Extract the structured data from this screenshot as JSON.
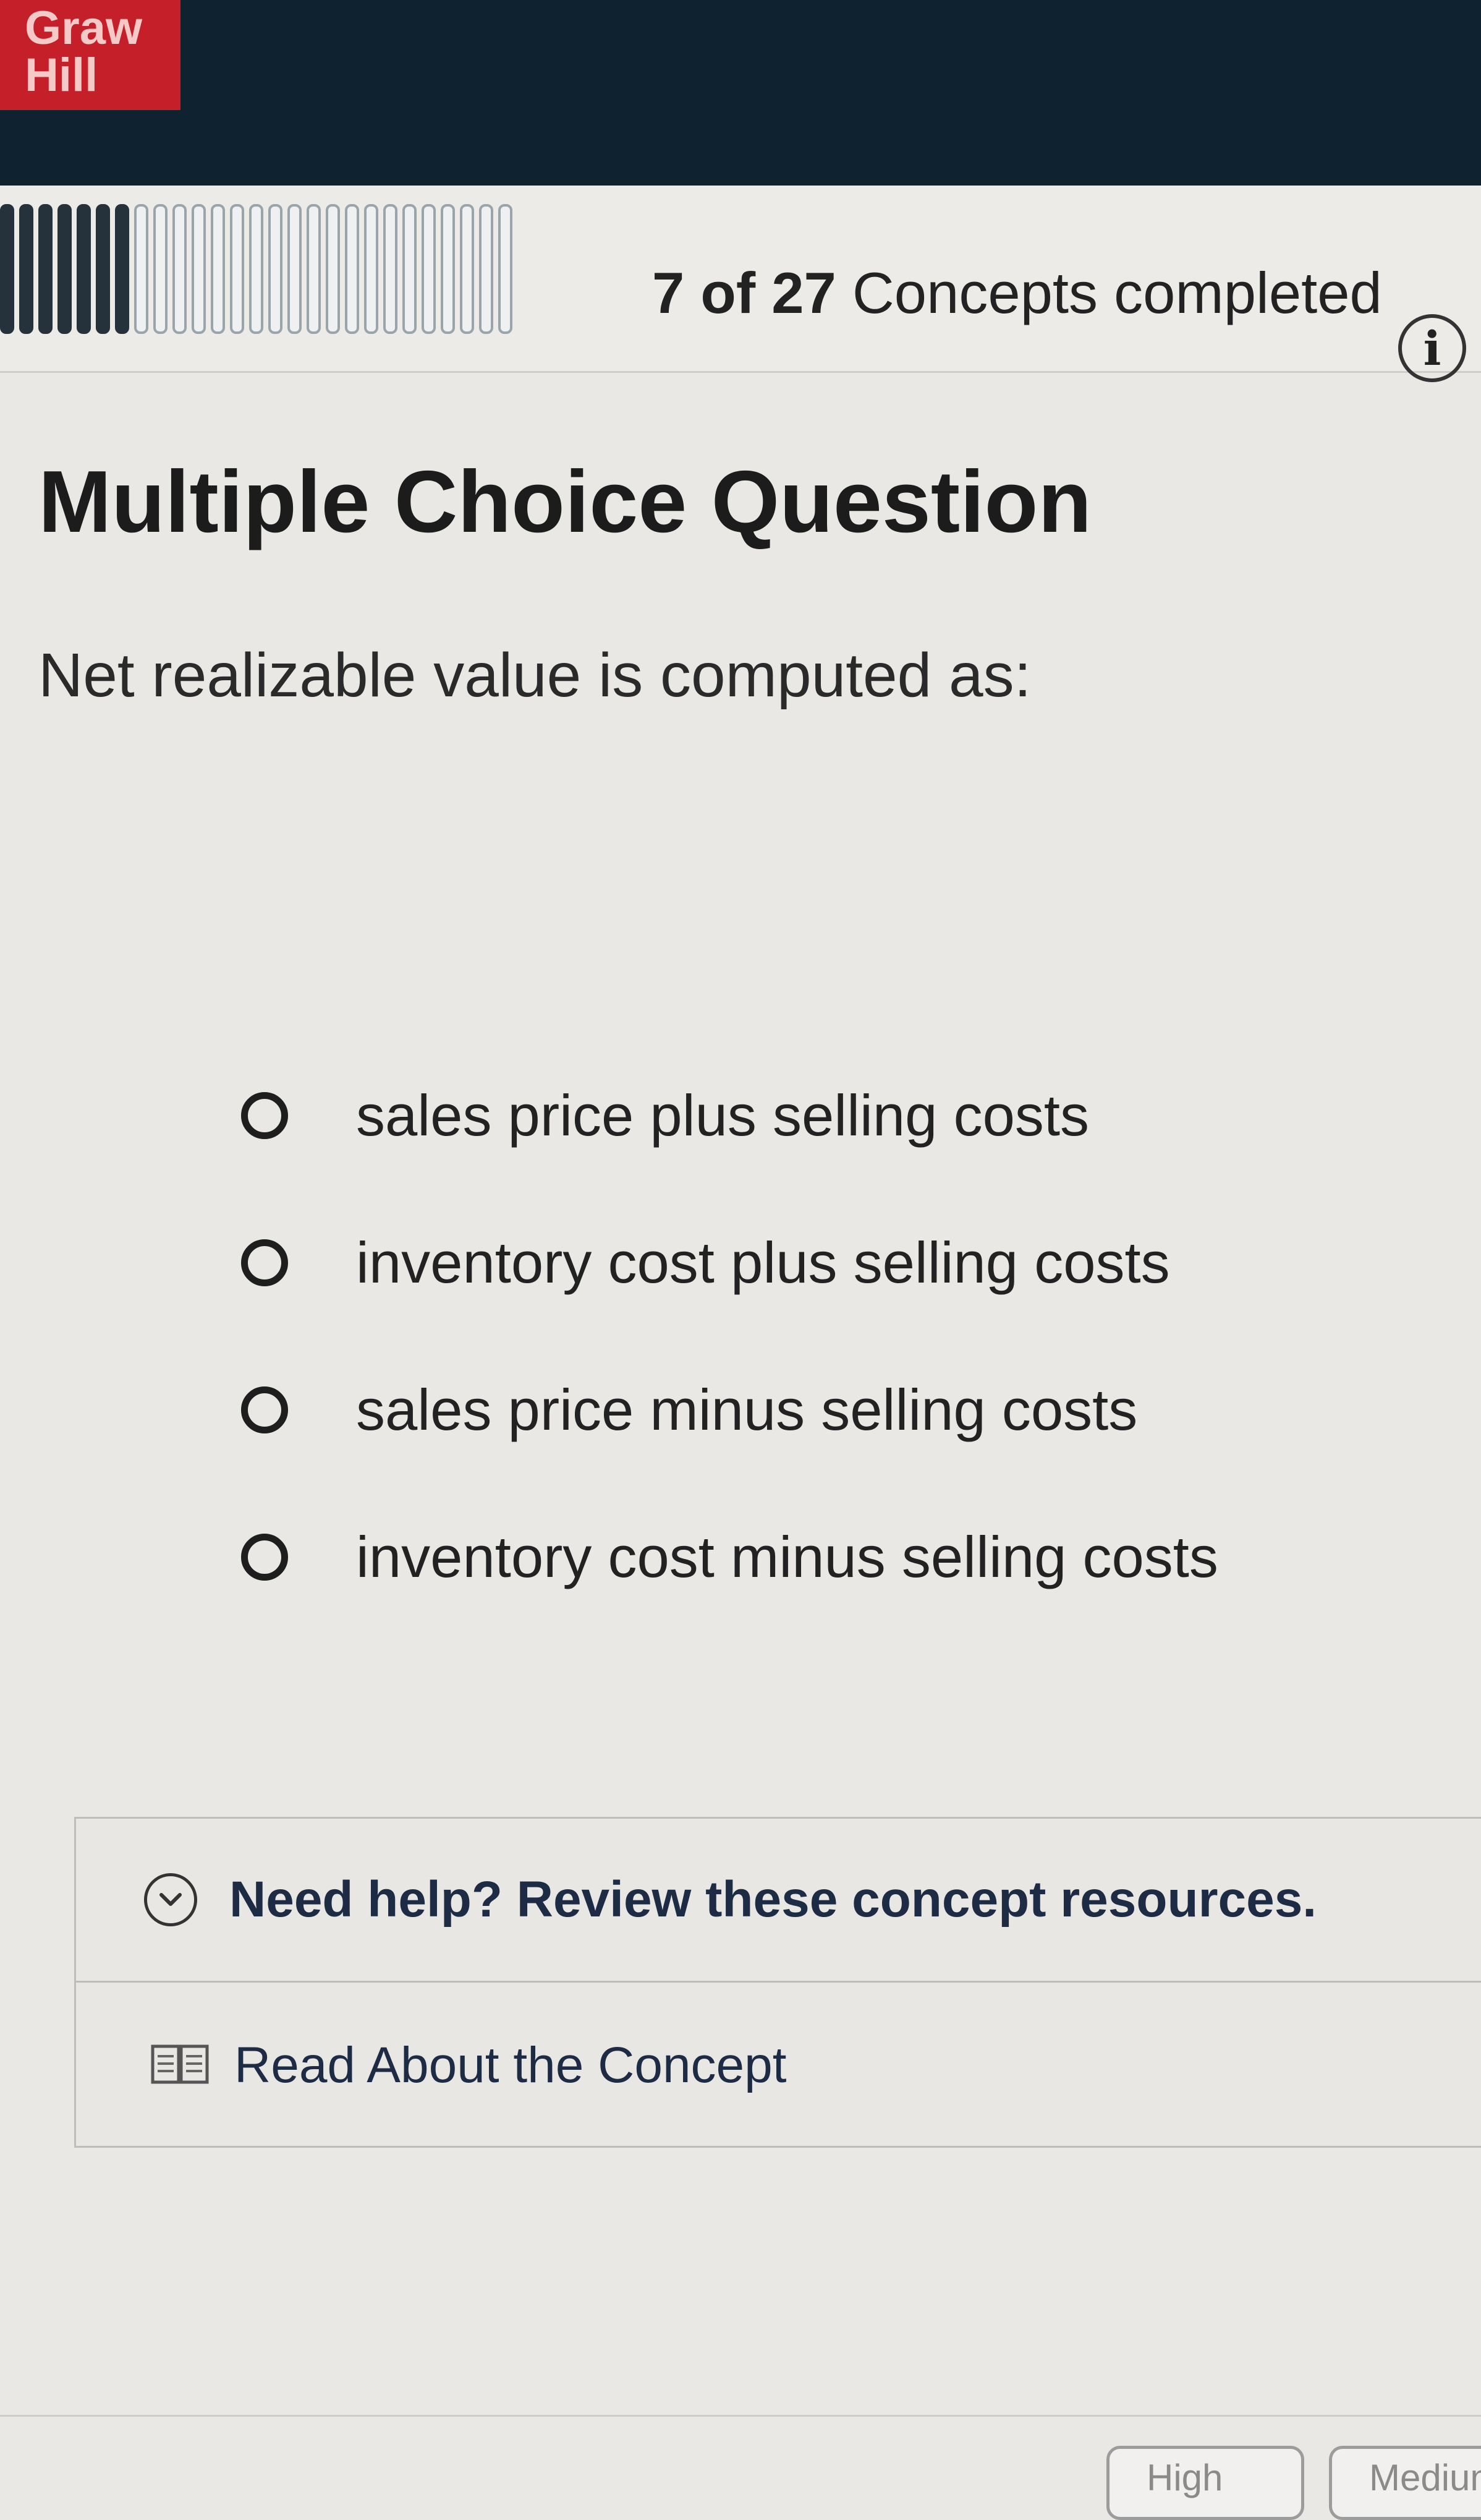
{
  "brand": {
    "logo_text_line1": "Graw",
    "logo_text_line2": "Hill"
  },
  "progress": {
    "completed": 7,
    "total": 27,
    "text_num": "7 of 27",
    "text_suffix": " Concepts completed"
  },
  "question": {
    "title": "Multiple Choice Question",
    "prompt": "Net realizable value is computed as:",
    "options": [
      {
        "label": "sales price plus selling costs"
      },
      {
        "label": "inventory cost plus selling costs"
      },
      {
        "label": "sales price minus selling costs"
      },
      {
        "label": "inventory cost minus selling costs"
      }
    ]
  },
  "help": {
    "title": "Need help? Review these concept resources.",
    "read_label": "Read About the Concept"
  },
  "confidence": {
    "buttons": [
      "High",
      "Medium"
    ]
  },
  "colors": {
    "brand_red": "#c51f2a",
    "top_bar": "#0f2230",
    "link_navy": "#1e2b45"
  },
  "icons": [
    "info-icon",
    "chevron-down-icon",
    "book-icon",
    "radio-icon"
  ]
}
